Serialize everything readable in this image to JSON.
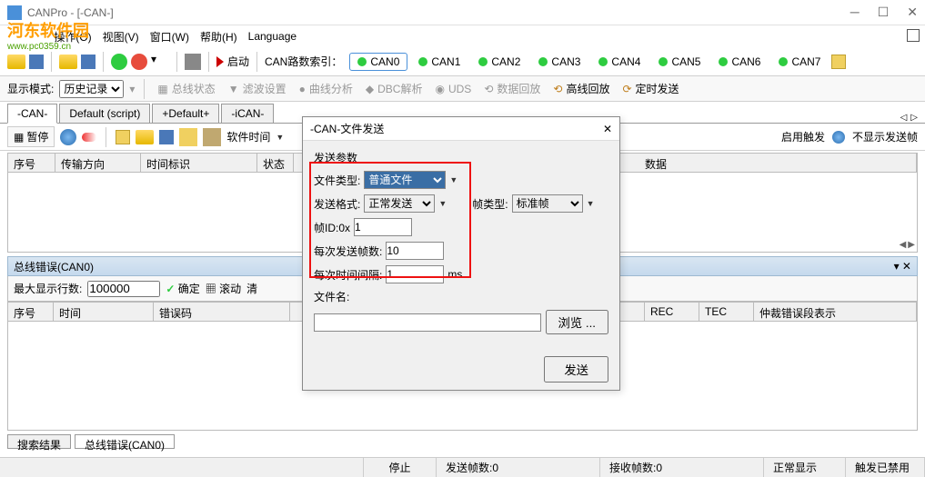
{
  "title": "CANPro - [-CAN-]",
  "menubar": [
    "文件(F)",
    "操作(O)",
    "视图(V)",
    "窗口(W)",
    "帮助(H)",
    "Language"
  ],
  "watermark": {
    "main": "河东软件园",
    "sub": "www.pc0359.cn"
  },
  "toolbar1": {
    "start_label": "启动",
    "canroute_label": "CAN路数索引：",
    "cans": [
      "CAN0",
      "CAN1",
      "CAN2",
      "CAN3",
      "CAN4",
      "CAN5",
      "CAN6",
      "CAN7"
    ]
  },
  "toolbar2": {
    "display_mode_label": "显示模式:",
    "display_mode_value": "历史记录",
    "btns": [
      "总线状态",
      "滤波设置",
      "曲线分析",
      "DBC解析",
      "UDS",
      "数据回放",
      "高线回放",
      "定时发送"
    ]
  },
  "tabs": [
    "-CAN-",
    "Default (script)",
    "+Default+",
    "-iCAN-"
  ],
  "tabtoolbar": {
    "pause": "暂停",
    "soft_time": "软件时间",
    "enable_trigger": "启用触发",
    "no_show_send": "不显示发送帧"
  },
  "main_cols": {
    "seq": "序号",
    "dir": "传输方向",
    "time": "时间标识",
    "status": "状态",
    "data": "数据"
  },
  "err_panel": {
    "title": "总线错误(CAN0)",
    "max_rows_label": "最大显示行数:",
    "max_rows_value": "100000",
    "confirm": "确定",
    "scroll": "滚动",
    "clear": "清"
  },
  "err_cols": {
    "seq": "序号",
    "time": "时间",
    "code": "错误码",
    "rec": "REC",
    "tec": "TEC",
    "arbit": "仲裁错误段表示"
  },
  "bottom_tabs": [
    "搜索结果",
    "总线错误(CAN0)"
  ],
  "statusbar": {
    "stop": "停止",
    "send": "发送帧数:0",
    "recv": "接收帧数:0",
    "normal": "正常显示",
    "trigger": "触发已禁用"
  },
  "dialog": {
    "title": "-CAN-文件发送",
    "params_label": "发送参数",
    "file_type_label": "文件类型:",
    "file_type_value": "普通文件",
    "send_format_label": "发送格式:",
    "send_format_value": "正常发送",
    "frame_type_label": "帧类型:",
    "frame_type_value": "标准帧",
    "frame_id_label": "帧ID:0x",
    "frame_id_value": "1",
    "each_send_label": "每次发送帧数:",
    "each_send_value": "10",
    "each_interval_label": "每次时间间隔:",
    "each_interval_value": "1",
    "interval_unit": "ms",
    "filename_label": "文件名:",
    "filename_value": "",
    "browse": "浏览 ...",
    "send": "发送"
  }
}
